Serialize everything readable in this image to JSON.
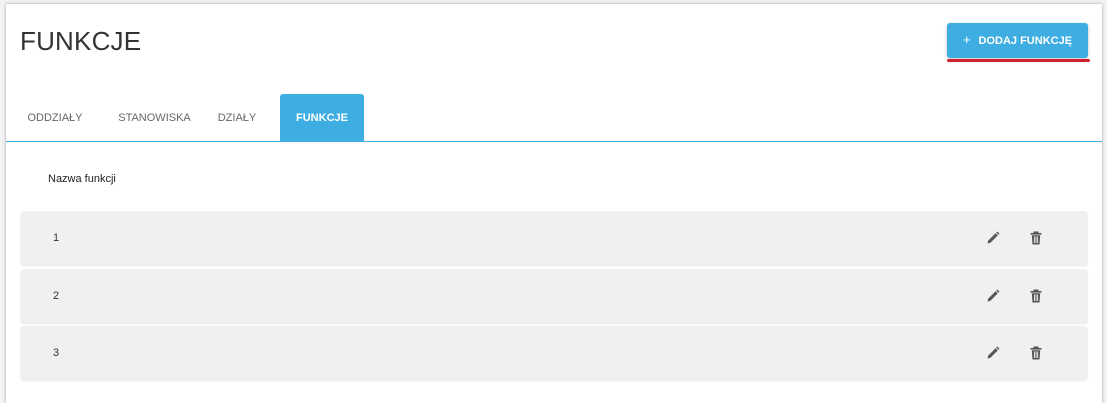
{
  "header": {
    "title": "FUNKCJE",
    "add_button_label": "DODAJ FUNKCJĘ",
    "add_button_icon": "plus-icon",
    "accent_color": "#3eaee2",
    "underline_color": "#d11f2f"
  },
  "tabs": [
    {
      "label": "ODDZIAŁY",
      "active": false
    },
    {
      "label": "STANOWISKA",
      "active": false
    },
    {
      "label": "DZIAŁY",
      "active": false
    },
    {
      "label": "FUNKCJE",
      "active": true
    }
  ],
  "table": {
    "column_header": "Nazwa funkcji",
    "rows": [
      {
        "name": "1",
        "actions": [
          "pencil-icon",
          "trash-icon"
        ]
      },
      {
        "name": "2",
        "actions": [
          "pencil-icon",
          "trash-icon"
        ]
      },
      {
        "name": "3",
        "actions": [
          "pencil-icon",
          "trash-icon"
        ]
      }
    ]
  }
}
